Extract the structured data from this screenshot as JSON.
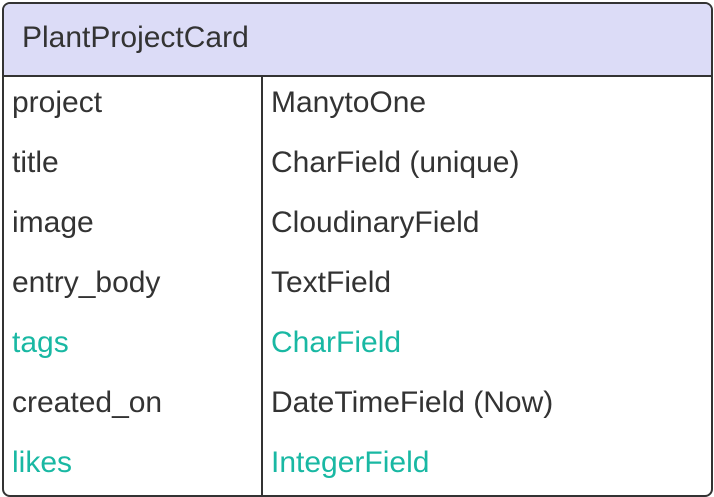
{
  "entity": {
    "title": "PlantProjectCard",
    "header_color": "#dcdcf7",
    "border_color": "#333333",
    "highlight_color": "#19b8a3"
  },
  "fields": [
    {
      "name": "project",
      "type": "ManytoOne",
      "highlighted": false
    },
    {
      "name": "title",
      "type": "CharField (unique)",
      "highlighted": false
    },
    {
      "name": "image",
      "type": "CloudinaryField",
      "highlighted": false
    },
    {
      "name": "entry_body",
      "type": "TextField",
      "highlighted": false
    },
    {
      "name": "tags",
      "type": "CharField",
      "highlighted": true
    },
    {
      "name": "created_on",
      "type": "DateTimeField (Now)",
      "highlighted": false
    },
    {
      "name": "likes",
      "type": "IntegerField",
      "highlighted": true
    }
  ]
}
